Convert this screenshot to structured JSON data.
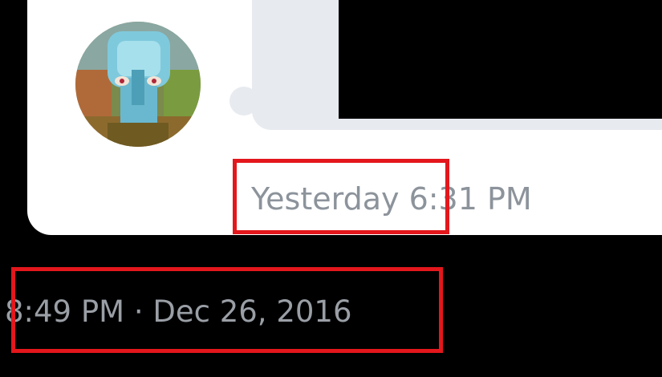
{
  "dm_thread": {
    "avatar_icon": "avatar-icon",
    "message_time": {
      "day": "Yesterday",
      "time": "6:31 PM"
    }
  },
  "tweet": {
    "date_line": "8:49 PM · Dec 26, 2016"
  },
  "highlight": {
    "color": "#e3171c"
  }
}
